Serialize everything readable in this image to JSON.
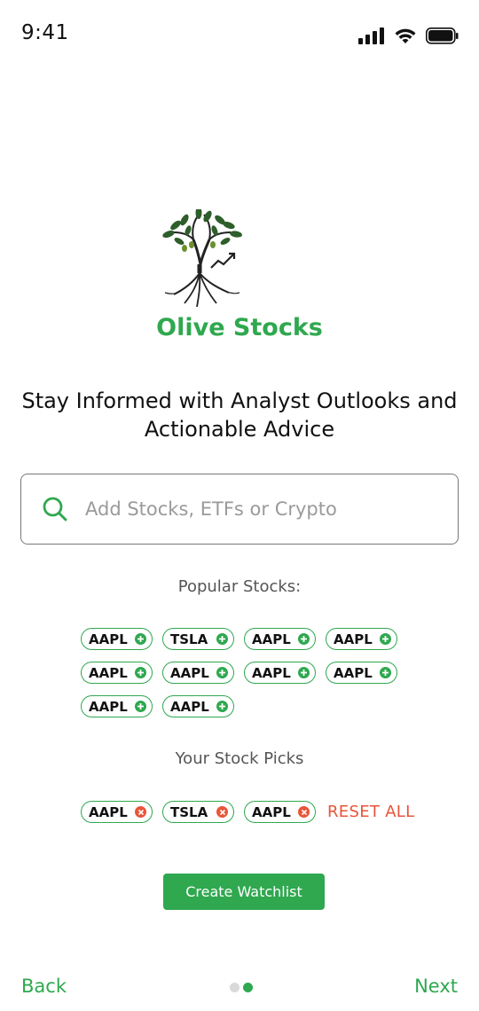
{
  "status_bar": {
    "time": "9:41",
    "icons": [
      "cellular-signal-icon",
      "wifi-icon",
      "battery-icon"
    ]
  },
  "brand": {
    "app_name": "Olive Stocks",
    "logo_icon": "olive-tree-chart-logo",
    "accent_color": "#2fa84f",
    "danger_color": "#e8553a"
  },
  "tagline": "Stay Informed with Analyst Outlooks and Actionable Advice",
  "search": {
    "placeholder": "Add Stocks, ETFs or Crypto",
    "value": "",
    "icon": "search-icon"
  },
  "popular": {
    "title": "Popular Stocks:",
    "chips": [
      {
        "label": "AAPL"
      },
      {
        "label": "TSLA"
      },
      {
        "label": "AAPL"
      },
      {
        "label": "AAPL"
      },
      {
        "label": "AAPL"
      },
      {
        "label": "AAPL"
      },
      {
        "label": "AAPL"
      },
      {
        "label": "AAPL"
      },
      {
        "label": "AAPL"
      },
      {
        "label": "AAPL"
      }
    ],
    "chip_icon": "add-circle-icon"
  },
  "picks": {
    "title": "Your Stock Picks",
    "chips": [
      {
        "label": "AAPL"
      },
      {
        "label": "TSLA"
      },
      {
        "label": "AAPL"
      }
    ],
    "chip_icon": "remove-circle-icon",
    "reset_label": "RESET ALL"
  },
  "actions": {
    "create_label": "Create Watchlist"
  },
  "navigation": {
    "back_label": "Back",
    "next_label": "Next",
    "pages": 2,
    "current_page": 2
  }
}
